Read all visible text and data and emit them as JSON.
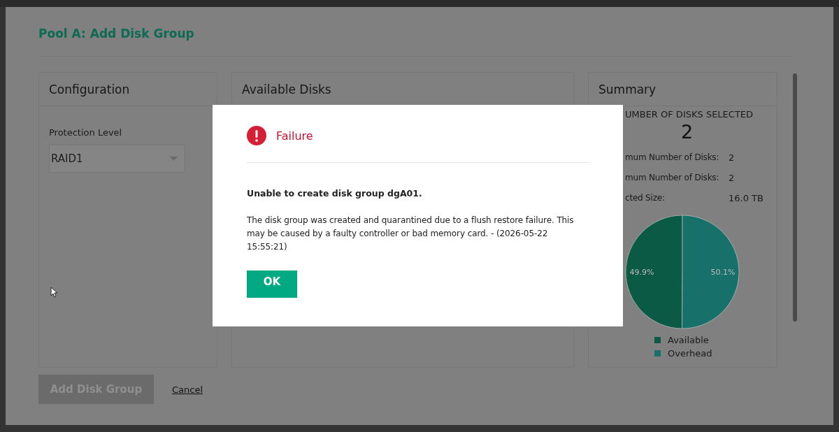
{
  "window": {
    "title": "Pool A: Add Disk Group"
  },
  "configuration": {
    "title": "Configuration",
    "field_label": "Protection Level",
    "value": "RAID1"
  },
  "available_disks": {
    "title": "Available Disks"
  },
  "summary": {
    "title": "Summary",
    "count_label": "UMBER OF DISKS SELECTED",
    "count": "2",
    "stats": [
      {
        "label": "mum Number of Disks:",
        "value": "2"
      },
      {
        "label": "mum Number of Disks:",
        "value": "2"
      },
      {
        "label": "cted Size:",
        "value": "16.0 TB"
      }
    ],
    "chart_data": {
      "type": "pie",
      "categories": [
        "Available",
        "Overhead"
      ],
      "values": [
        49.9,
        50.1
      ],
      "value_labels": [
        "49.9%",
        "50.1%"
      ]
    },
    "legend": [
      {
        "color": "#0b5a45"
      },
      {
        "color": "#17706a"
      }
    ]
  },
  "footer": {
    "add_button": {
      "label": "Add Disk Group",
      "disabled": true
    },
    "cancel": "Cancel"
  },
  "dialog": {
    "title": "Failure",
    "heading": "Unable to create disk group dgA01.",
    "message": "The disk group was created and quarantined due to a flush restore failure. This may be caused by a faulty controller or bad memory card. - (2026-05-22 15:55:21)",
    "button": "OK"
  }
}
